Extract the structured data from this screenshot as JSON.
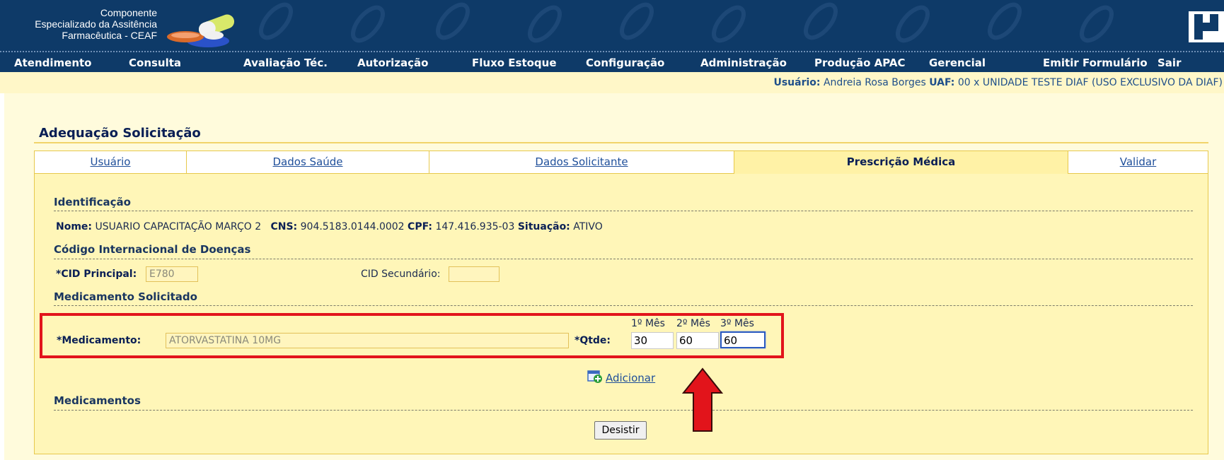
{
  "header": {
    "brand_line1": "Componente",
    "brand_line2": "Especializado da Assitência",
    "brand_line3": "Farmacêutica - CEAF"
  },
  "menu": [
    {
      "label": "Atendimento"
    },
    {
      "label": "Consulta"
    },
    {
      "label": "Avaliação Téc."
    },
    {
      "label": "Autorização"
    },
    {
      "label": "Fluxo Estoque"
    },
    {
      "label": "Configuração"
    },
    {
      "label": "Administração"
    },
    {
      "label": "Produção APAC"
    },
    {
      "label": "Gerencial"
    },
    {
      "label": "Emitir Formulário"
    },
    {
      "label": "Sair"
    }
  ],
  "user_info": {
    "user_label": "Usuário:",
    "user_name": "Andreia Rosa Borges",
    "uaf_label": "UAF:",
    "uaf_value": "00 x UNIDADE TESTE DIAF (USO EXCLUSIVO DA DIAF)"
  },
  "page_title": "Adequação Solicitação",
  "tabs": [
    {
      "label": "Usuário",
      "active": false
    },
    {
      "label": "Dados Saúde",
      "active": false
    },
    {
      "label": "Dados Solicitante",
      "active": false
    },
    {
      "label": "Prescrição Médica",
      "active": true
    },
    {
      "label": "Validar",
      "active": false
    }
  ],
  "identificacao": {
    "title": "Identificação",
    "nome_label": "Nome:",
    "nome_value": "USUARIO CAPACITAÇÃO MARÇO 2",
    "cns_label": "CNS:",
    "cns_value": "904.5183.0144.0002",
    "cpf_label": "CPF:",
    "cpf_value": "147.416.935-03",
    "situacao_label": "Situação:",
    "situacao_value": "ATIVO"
  },
  "cid": {
    "title": "Código Internacional de Doenças",
    "principal_label": "*CID Principal:",
    "principal_value": "E780",
    "secundario_label": "CID Secundário:",
    "secundario_value": ""
  },
  "medicamento_solicitado": {
    "title": "Medicamento Solicitado",
    "medicamento_label": "*Medicamento:",
    "medicamento_value": "ATORVASTATINA 10MG",
    "qtde_label": "*Qtde:",
    "month_headers": [
      "1º Mês",
      "2º Mês",
      "3º Mês"
    ],
    "quantities": [
      "30",
      "60",
      "60"
    ]
  },
  "adicionar_label": "Adicionar",
  "medicamentos_title": "Medicamentos",
  "desistir_label": "Desistir",
  "colors": {
    "header_bg": "#0e3a68",
    "panel_bg": "#fff6b8",
    "highlight_red": "#e2141b"
  }
}
